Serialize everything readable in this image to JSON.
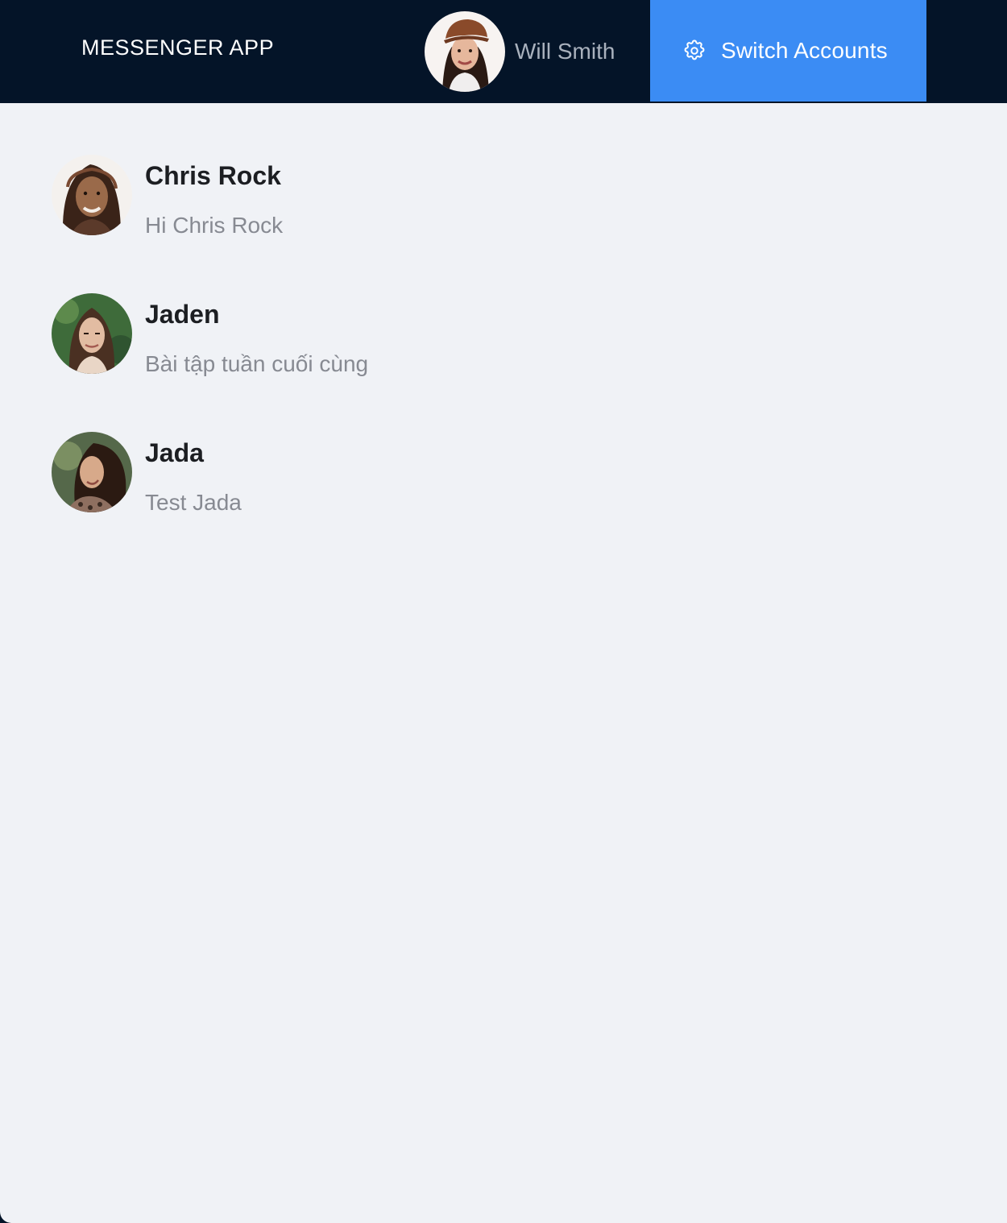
{
  "app": {
    "title": "MESSENGER APP"
  },
  "header": {
    "current_user": {
      "name": "Will Smith",
      "avatar_icon": "user-avatar-photo"
    },
    "switch_button": {
      "label": "Switch Accounts",
      "icon": "gear-icon",
      "color": "#3b8cf4"
    },
    "background": "#041428"
  },
  "conversations": [
    {
      "name": "Chris Rock",
      "last_message": "Hi Chris Rock"
    },
    {
      "name": "Jaden",
      "last_message": "Bài tập tuần cuối cùng"
    },
    {
      "name": "Jada",
      "last_message": "Test Jada"
    }
  ]
}
